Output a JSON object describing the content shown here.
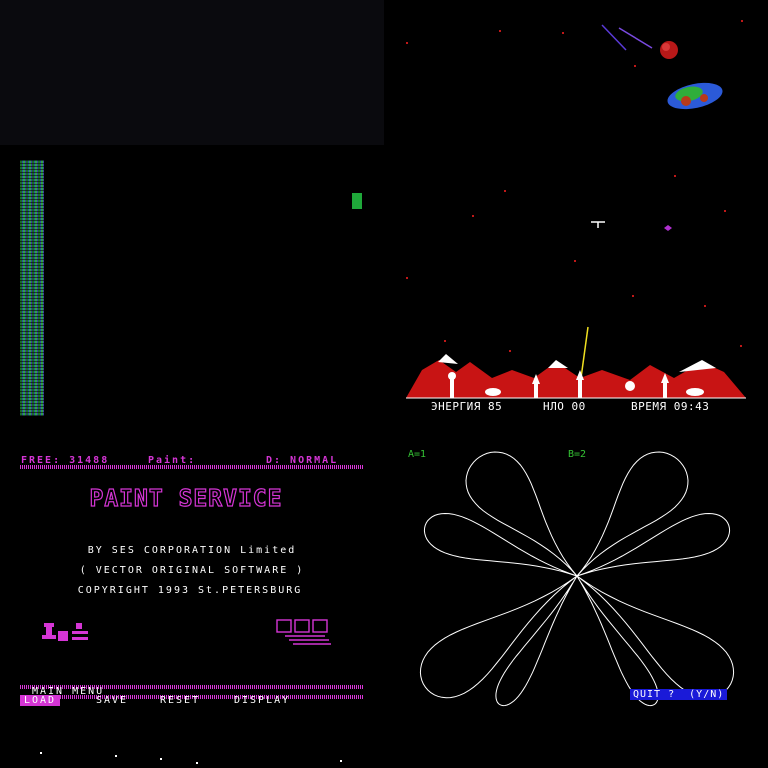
{
  "game_hud": {
    "energy_label": "ЭНЕРГИЯ 85",
    "ufo_label": "НЛО 00",
    "time_label": "ВРЕМЯ 09:43"
  },
  "paint_service": {
    "status_free": "FREE: 31488",
    "status_paint": "Paint:",
    "status_mode": "D: NORMAL",
    "title": "PAINT SERVICE",
    "credit_line1": "BY SES CORPORATION Limited",
    "credit_line2": "( VECTOR ORIGINAL SOFTWARE )",
    "credit_line3": "COPYRIGHT 1993    St.PETERSBURG",
    "menu_title": "MAIN MENU",
    "menu_items": [
      "LOAD",
      "SAVE",
      "RESET",
      "DISPLAY"
    ],
    "selected_index": 0
  },
  "plot": {
    "a_label": "A=1",
    "b_label": "B=2",
    "quit_prompt": "QUIT ?  (Y/N)"
  },
  "colors": {
    "magenta": "#d535d5",
    "plot_green": "#34c234",
    "prompt_blue": "#1a1ad8",
    "snow_red": "#c81414"
  }
}
